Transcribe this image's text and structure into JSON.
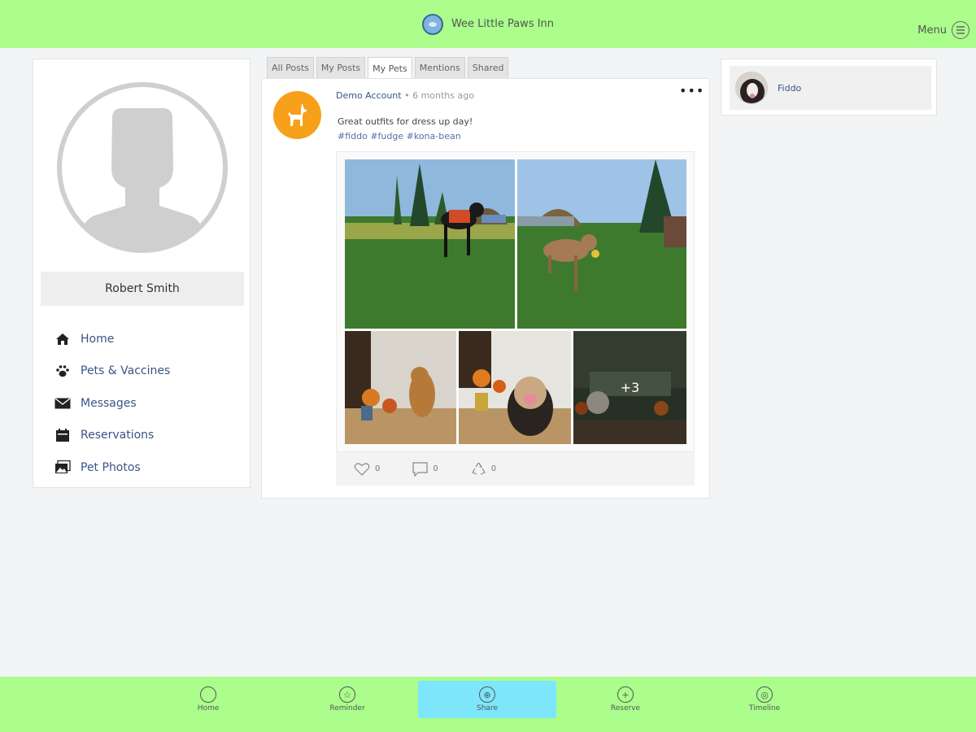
{
  "header": {
    "app_name": "Wee Little Paws Inn",
    "menu_label": "Menu"
  },
  "profile": {
    "name": "Robert Smith",
    "nav": [
      {
        "label": "Home",
        "icon": "home-icon"
      },
      {
        "label": "Pets & Vaccines",
        "icon": "paw-icon"
      },
      {
        "label": "Messages",
        "icon": "envelope-icon"
      },
      {
        "label": "Reservations",
        "icon": "calendar-icon"
      },
      {
        "label": "Pet Photos",
        "icon": "photos-icon"
      }
    ]
  },
  "tabs": [
    {
      "label": "All Posts",
      "active": false
    },
    {
      "label": "My Posts",
      "active": false
    },
    {
      "label": "My Pets",
      "active": true
    },
    {
      "label": "Mentions",
      "active": false
    },
    {
      "label": "Shared",
      "active": false
    }
  ],
  "post": {
    "author": "Demo Account",
    "time": "• 6 months ago",
    "text": "Great outfits for dress up day!",
    "tags": "#fiddo #fudge #kona-bean",
    "more_count": "+3",
    "likes": "0",
    "comments": "0",
    "shares": "0"
  },
  "pets": [
    {
      "name": "Fiddo"
    }
  ],
  "bottom_nav": [
    {
      "label": "Home",
      "icon": "home-circle-icon",
      "active": false
    },
    {
      "label": "Reminder",
      "icon": "star-icon",
      "active": false
    },
    {
      "label": "Share",
      "icon": "share-icon",
      "active": true
    },
    {
      "label": "Reserve",
      "icon": "plus-icon",
      "active": false
    },
    {
      "label": "Timeline",
      "icon": "timeline-icon",
      "active": false
    }
  ],
  "colors": {
    "topbar": "#abfd8c",
    "accent_active": "#7de6fb",
    "link": "#3a5485",
    "post_avatar": "#f7a01a"
  }
}
